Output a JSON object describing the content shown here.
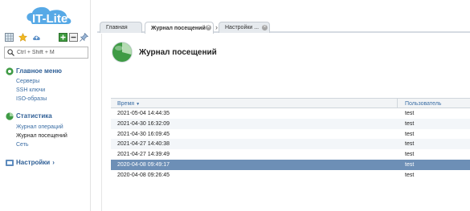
{
  "app": {
    "logo_text": "IT-Lite"
  },
  "sidebar": {
    "search": {
      "placeholder": "Ctrl + Shift + M"
    },
    "main_menu": {
      "title": "Главное меню",
      "items": [
        {
          "label": "Серверы"
        },
        {
          "label": "SSH ключи"
        },
        {
          "label": "ISO-образы"
        }
      ]
    },
    "statistics": {
      "title": "Статистика",
      "items": [
        {
          "label": "Журнал операций"
        },
        {
          "label": "Журнал посещений"
        },
        {
          "label": "Сеть"
        }
      ]
    },
    "settings": {
      "title": "Настройки",
      "arrow": "›"
    }
  },
  "tabs": [
    {
      "label": "Главная"
    },
    {
      "label": "Журнал посещений"
    },
    {
      "label": "Настройки ..."
    }
  ],
  "page": {
    "title": "Журнал посещений"
  },
  "table": {
    "columns": [
      "Время",
      "Пользователь"
    ],
    "sort_arrow": "▼",
    "rows": [
      {
        "time": "2021-05-04 14:44:35",
        "user": "test"
      },
      {
        "time": "2021-04-30 16:32:09",
        "user": "test"
      },
      {
        "time": "2021-04-30 16:09:45",
        "user": "test"
      },
      {
        "time": "2021-04-27 14:40:38",
        "user": "test"
      },
      {
        "time": "2021-04-27 14:39:49",
        "user": "test"
      },
      {
        "time": "2020-04-08 09:49:17",
        "user": "test"
      },
      {
        "time": "2020-04-08 09:26:45",
        "user": "test"
      }
    ],
    "selected_row_index": 5
  },
  "colors": {
    "accent": "#2f5f96",
    "selected_row": "#6d8fb6",
    "link": "#3b6ea5"
  }
}
